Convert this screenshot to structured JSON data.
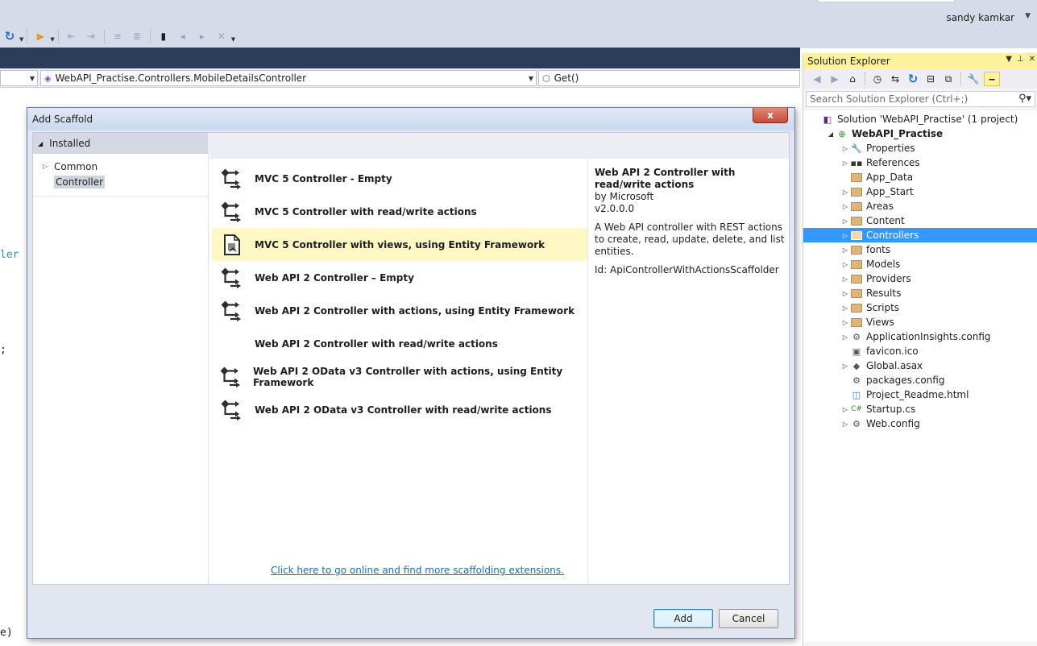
{
  "user": {
    "name": "sandy kamkar"
  },
  "editor_nav": {
    "type_name": "WebAPI_Practise.Controllers.MobileDetailsController",
    "member_name": "Get()"
  },
  "editor_fragments": [
    "ler",
    ";",
    "e)"
  ],
  "solution_explorer": {
    "title": "Solution Explorer",
    "search_placeholder": "Search Solution Explorer (Ctrl+;)",
    "items": [
      {
        "label": "Solution 'WebAPI_Practise' (1 project)",
        "icon": "solution-icon",
        "expand": "",
        "indent": 0
      },
      {
        "label": "WebAPI_Practise",
        "icon": "web-project-icon",
        "expand": "◢",
        "indent": 1,
        "bold": true
      },
      {
        "label": "Properties",
        "icon": "wrench-icon",
        "expand": "▷",
        "indent": 2
      },
      {
        "label": "References",
        "icon": "references-icon",
        "expand": "▷",
        "indent": 2
      },
      {
        "label": "App_Data",
        "icon": "folder-icon",
        "expand": "",
        "indent": 2
      },
      {
        "label": "App_Start",
        "icon": "folder-icon",
        "expand": "▷",
        "indent": 2
      },
      {
        "label": "Areas",
        "icon": "folder-icon",
        "expand": "▷",
        "indent": 2
      },
      {
        "label": "Content",
        "icon": "folder-icon",
        "expand": "▷",
        "indent": 2
      },
      {
        "label": "Controllers",
        "icon": "folder-icon",
        "expand": "▷",
        "indent": 2,
        "selected": true
      },
      {
        "label": "fonts",
        "icon": "folder-icon",
        "expand": "▷",
        "indent": 2
      },
      {
        "label": "Models",
        "icon": "folder-icon",
        "expand": "▷",
        "indent": 2
      },
      {
        "label": "Providers",
        "icon": "folder-icon",
        "expand": "▷",
        "indent": 2
      },
      {
        "label": "Results",
        "icon": "folder-icon",
        "expand": "▷",
        "indent": 2
      },
      {
        "label": "Scripts",
        "icon": "folder-icon",
        "expand": "▷",
        "indent": 2
      },
      {
        "label": "Views",
        "icon": "folder-icon",
        "expand": "▷",
        "indent": 2
      },
      {
        "label": "ApplicationInsights.config",
        "icon": "config-file-icon",
        "expand": "▷",
        "indent": 2
      },
      {
        "label": "favicon.ico",
        "icon": "image-file-icon",
        "expand": "",
        "indent": 2
      },
      {
        "label": "Global.asax",
        "icon": "asax-file-icon",
        "expand": "▷",
        "indent": 2
      },
      {
        "label": "packages.config",
        "icon": "config-file-icon",
        "expand": "",
        "indent": 2
      },
      {
        "label": "Project_Readme.html",
        "icon": "html-file-icon",
        "expand": "",
        "indent": 2
      },
      {
        "label": "Startup.cs",
        "icon": "csharp-file-icon",
        "expand": "▷",
        "indent": 2
      },
      {
        "label": "Web.config",
        "icon": "config-file-icon",
        "expand": "▷",
        "indent": 2
      }
    ]
  },
  "dialog": {
    "title": "Add Scaffold",
    "close_label": "x",
    "installed_label": "Installed",
    "categories": [
      {
        "label": "Common",
        "expand": "▷"
      },
      {
        "label": "Controller",
        "expand": "",
        "selected": true
      }
    ],
    "templates": [
      {
        "label": "MVC 5 Controller - Empty",
        "icon": "scaffold-controller-icon",
        "state": ""
      },
      {
        "label": "MVC 5 Controller with read/write actions",
        "icon": "scaffold-controller-icon",
        "state": ""
      },
      {
        "label": "MVC 5 Controller with views, using Entity Framework",
        "icon": "scaffold-views-icon",
        "state": "hover"
      },
      {
        "label": "Web API 2 Controller – Empty",
        "icon": "scaffold-controller-icon",
        "state": ""
      },
      {
        "label": "Web API 2 Controller with actions, using Entity Framework",
        "icon": "scaffold-controller-icon",
        "state": ""
      },
      {
        "label": "Web API 2 Controller with read/write actions",
        "icon": "scaffold-controller-icon",
        "state": "selected"
      },
      {
        "label": "Web API 2 OData v3 Controller with actions, using Entity Framework",
        "icon": "scaffold-controller-icon",
        "state": ""
      },
      {
        "label": "Web API 2 OData v3 Controller with read/write actions",
        "icon": "scaffold-controller-icon",
        "state": ""
      }
    ],
    "details": {
      "title": "Web API 2 Controller with read/write actions",
      "author": "by Microsoft",
      "version": "v2.0.0.0",
      "description": "A Web API controller with REST actions to create, read, update, delete, and list entities.",
      "id": "Id: ApiControllerWithActionsScaffolder"
    },
    "online_link": "Click here to go online and find more scaffolding extensions.",
    "add_button": "Add",
    "cancel_button": "Cancel"
  },
  "colors": {
    "selection": "#3399ff",
    "hover_highlight": "#fff7c4",
    "solution_explorer_title": "#fff29d",
    "nav_band": "#2c3d5b",
    "link": "#0e70c0"
  }
}
